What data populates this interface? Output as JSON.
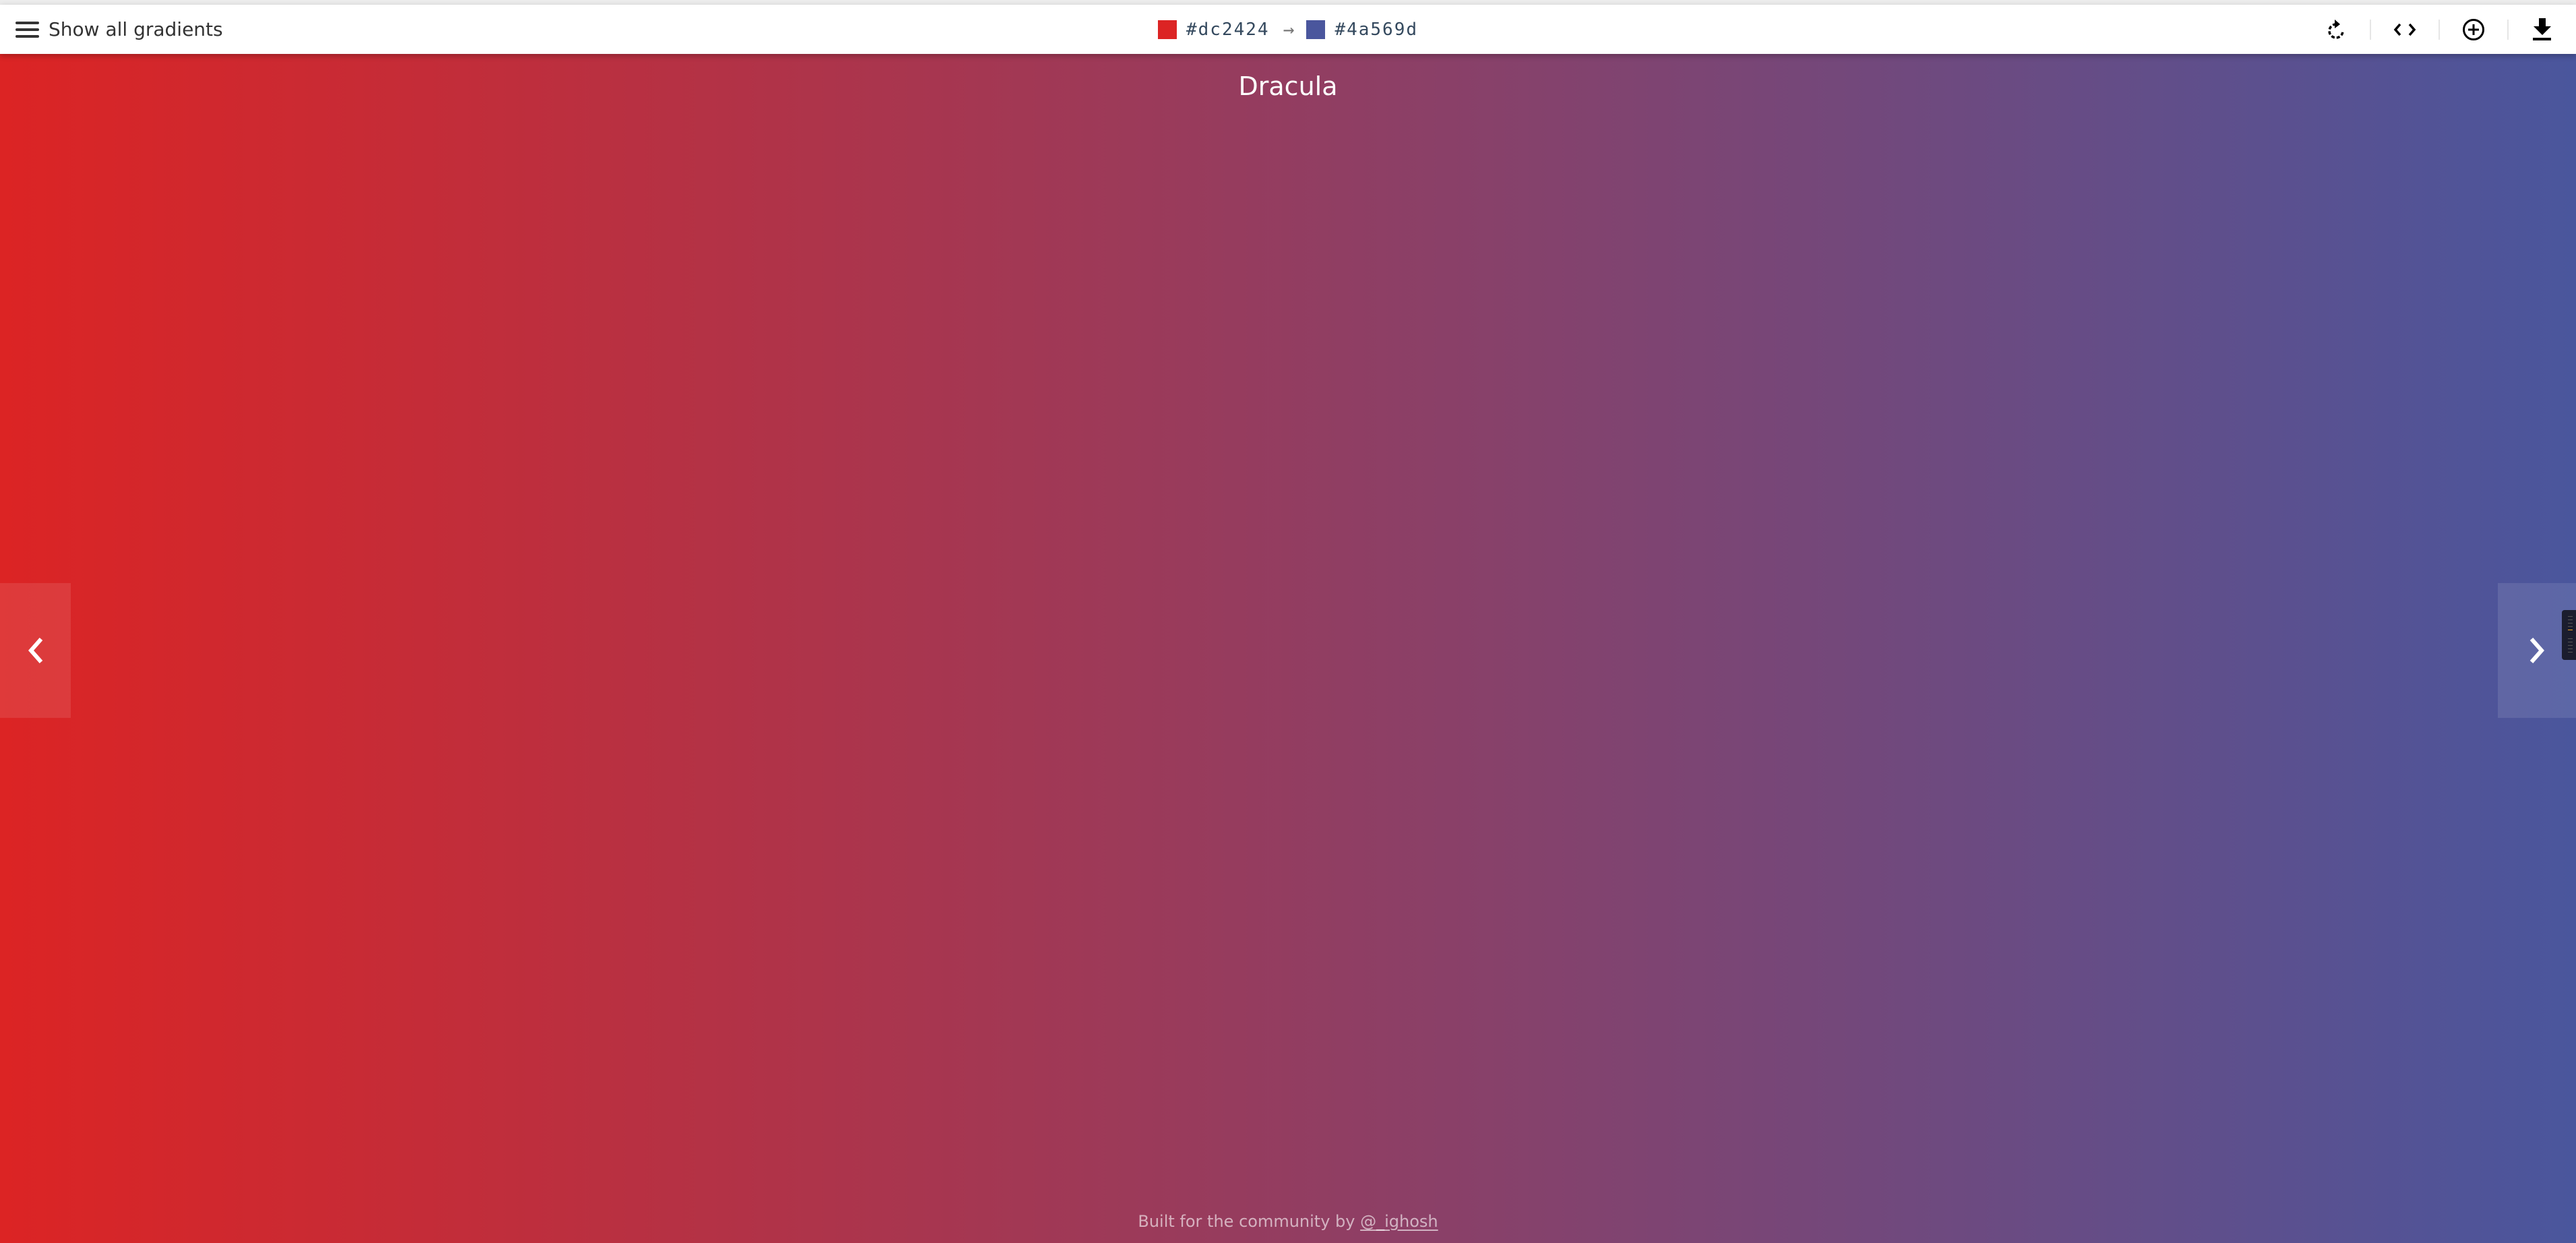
{
  "header": {
    "menu_label": "Show all gradients",
    "from_color": "#dc2424",
    "to_color": "#4a569d",
    "arrow": "→",
    "tools": [
      "rotate-icon",
      "code-icon",
      "add-icon",
      "download-icon"
    ]
  },
  "gradient": {
    "name": "Dracula",
    "direction": "to right"
  },
  "nav": {
    "prev_icon": "chevron-left-icon",
    "next_icon": "chevron-right-icon"
  },
  "footer": {
    "text": "Built for the community by ",
    "link": "@_ighosh"
  }
}
